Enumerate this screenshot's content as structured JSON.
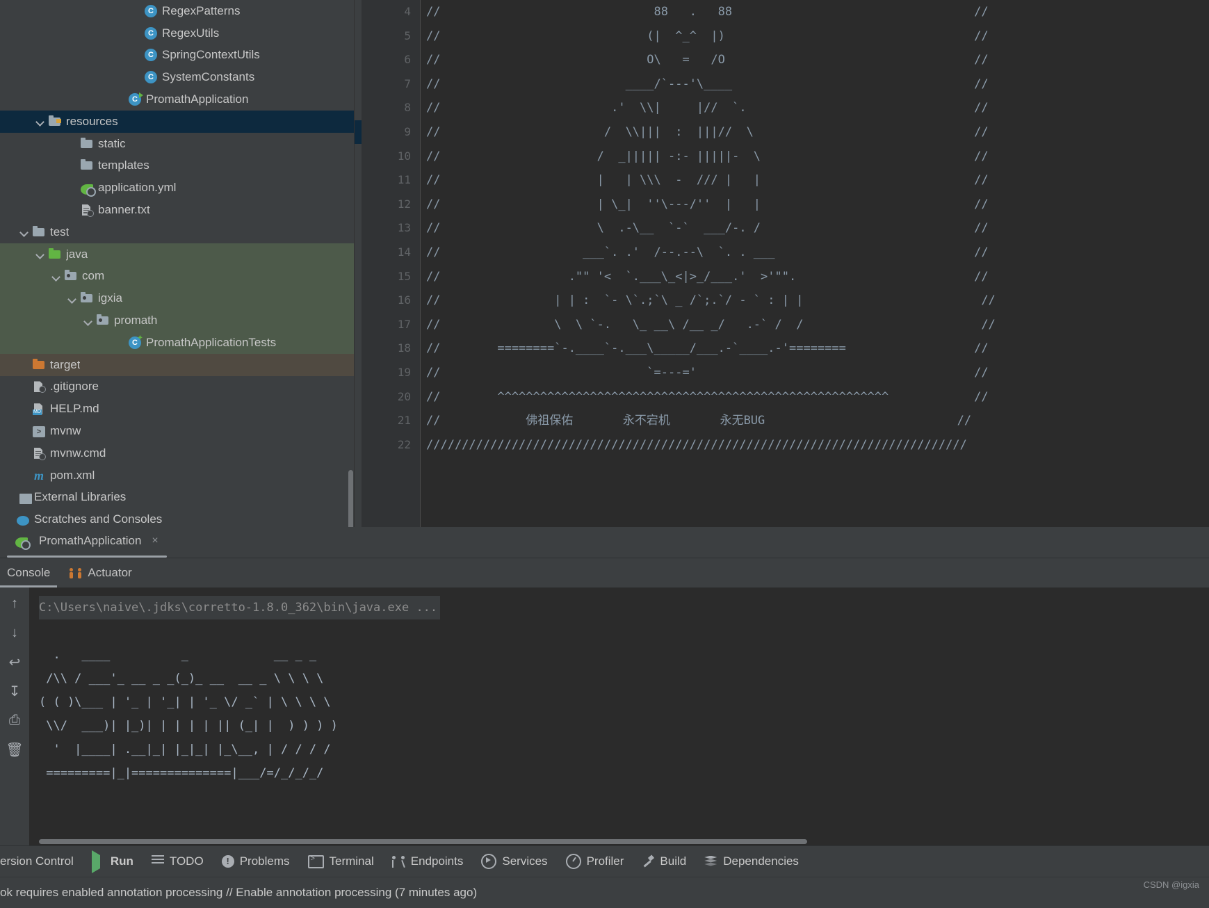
{
  "project_tree": [
    {
      "label": "RegexPatterns",
      "icon": "java-class-icon",
      "indent": 8,
      "chevron": false,
      "state": "normal"
    },
    {
      "label": "RegexUtils",
      "icon": "java-class-icon",
      "indent": 8,
      "chevron": false,
      "state": "normal"
    },
    {
      "label": "SpringContextUtils",
      "icon": "java-class-icon",
      "indent": 8,
      "chevron": false,
      "state": "normal"
    },
    {
      "label": "SystemConstants",
      "icon": "java-class-icon",
      "indent": 8,
      "chevron": false,
      "state": "normal"
    },
    {
      "label": "PromathApplication",
      "icon": "spring-boot-run-icon",
      "indent": 7,
      "chevron": false,
      "state": "normal"
    },
    {
      "label": "resources",
      "icon": "resources-folder-icon",
      "indent": 2,
      "chevron": true,
      "state": "selected"
    },
    {
      "label": "static",
      "icon": "folder-icon",
      "indent": 4,
      "chevron": false,
      "state": "normal"
    },
    {
      "label": "templates",
      "icon": "folder-icon",
      "indent": 4,
      "chevron": false,
      "state": "normal"
    },
    {
      "label": "application.yml",
      "icon": "spring-yaml-icon",
      "indent": 4,
      "chevron": false,
      "state": "normal"
    },
    {
      "label": "banner.txt",
      "icon": "text-file-icon",
      "indent": 4,
      "chevron": false,
      "state": "normal"
    },
    {
      "label": "test",
      "icon": "folder-icon",
      "indent": 1,
      "chevron": true,
      "state": "normal"
    },
    {
      "label": "java",
      "icon": "source-folder-icon",
      "indent": 2,
      "chevron": true,
      "state": "module"
    },
    {
      "label": "com",
      "icon": "package-folder-icon",
      "indent": 3,
      "chevron": true,
      "state": "module"
    },
    {
      "label": "igxia",
      "icon": "package-folder-icon",
      "indent": 4,
      "chevron": true,
      "state": "module"
    },
    {
      "label": "promath",
      "icon": "package-folder-icon",
      "indent": 5,
      "chevron": true,
      "state": "module"
    },
    {
      "label": "PromathApplicationTests",
      "icon": "java-test-class-icon",
      "indent": 7,
      "chevron": false,
      "state": "module"
    },
    {
      "label": "target",
      "icon": "excluded-folder-icon",
      "indent": 1,
      "chevron": false,
      "state": "excluded"
    },
    {
      "label": ".gitignore",
      "icon": "gitignore-file-icon",
      "indent": 1,
      "chevron": false,
      "state": "normal"
    },
    {
      "label": "HELP.md",
      "icon": "markdown-file-icon",
      "indent": 1,
      "chevron": false,
      "state": "normal"
    },
    {
      "label": "mvnw",
      "icon": "shell-script-icon",
      "indent": 1,
      "chevron": false,
      "state": "normal"
    },
    {
      "label": "mvnw.cmd",
      "icon": "text-file-icon",
      "indent": 1,
      "chevron": false,
      "state": "normal"
    },
    {
      "label": "pom.xml",
      "icon": "maven-file-icon",
      "indent": 1,
      "chevron": false,
      "state": "normal"
    },
    {
      "label": "External Libraries",
      "icon": "external-libraries-icon",
      "indent": 0,
      "chevron": false,
      "state": "normal"
    },
    {
      "label": "Scratches and Consoles",
      "icon": "scratches-icon",
      "indent": 0,
      "chevron": false,
      "state": "normal"
    }
  ],
  "editor": {
    "line_numbers": [
      "4",
      "5",
      "6",
      "7",
      "8",
      "9",
      "10",
      "11",
      "12",
      "13",
      "14",
      "15",
      "16",
      "17",
      "18",
      "19",
      "20",
      "21",
      "22"
    ],
    "selected_line": "9",
    "lines": [
      "//                              88   .   88                                  //",
      "//                             (|  ^_^  |)                                   //",
      "//                             O\\   =   /O                                   //",
      "//                          ____/`---'\\____                                  //",
      "//                        .'  \\\\|     |//  `.                                //",
      "//                       /  \\\\|||  :  |||//  \\                               //",
      "//                      /  _||||| -:- |||||-  \\                              //",
      "//                      |   | \\\\\\  -  /// |   |                              //",
      "//                      | \\_|  ''\\---/''  |   |                              //",
      "//                      \\  .-\\__  `-`  ___/-. /                              //",
      "//                    ___`. .'  /--.--\\  `. . ___                            //",
      "//                  .\"\" '<  `.___\\_<|>_/___.'  >'\"\".                         //",
      "//                | | :  `- \\`.;`\\ _ /`;.`/ - ` : | |                         //",
      "//                \\  \\ `-.   \\_ __\\ /__ _/   .-` /  /                         //",
      "//        ========`-.____`-.___\\_____/___.-`____.-'========                  //",
      "//                             `=---='                                       //",
      "//        ^^^^^^^^^^^^^^^^^^^^^^^^^^^^^^^^^^^^^^^^^^^^^^^^^^^^^^^            //",
      "//            佛祖保佑       永不宕机       永无BUG                           //",
      "////////////////////////////////////////////////////////////////////////////"
    ]
  },
  "run_window": {
    "tab_title": "PromathApplication",
    "close_label": "×",
    "sub_tabs": [
      {
        "label": "Console",
        "icon": "console-icon",
        "active": true
      },
      {
        "label": "Actuator",
        "icon": "actuator-icon",
        "active": false
      }
    ],
    "console": {
      "command_line": "C:\\Users\\naive\\.jdks\\corretto-1.8.0_362\\bin\\java.exe ...",
      "banner": [
        "  .   ____          _            __ _ _",
        " /\\\\ / ___'_ __ _ _(_)_ __  __ _ \\ \\ \\ \\",
        "( ( )\\___ | '_ | '_| | '_ \\/ _` | \\ \\ \\ \\",
        " \\\\/  ___)| |_)| | | | | || (_| |  ) ) ) )",
        "  '  |____| .__|_| |_|_| |_\\__, | / / / /",
        " =========|_|==============|___/=/_/_/_/"
      ]
    },
    "toolbar_icons": [
      {
        "name": "scroll-up-icon",
        "glyph": "↑"
      },
      {
        "name": "scroll-down-icon",
        "glyph": "↓"
      },
      {
        "name": "soft-wrap-icon",
        "glyph": "↩"
      },
      {
        "name": "scroll-to-end-icon",
        "glyph": "↧"
      },
      {
        "name": "print-icon",
        "glyph": "⎙"
      },
      {
        "name": "clear-all-icon",
        "glyph": "🗑"
      }
    ]
  },
  "bottom_toolbar": [
    {
      "label": "ersion Control",
      "icon": "version-control-icon",
      "active": false
    },
    {
      "label": "Run",
      "icon": "run-icon",
      "active": true
    },
    {
      "label": "TODO",
      "icon": "todo-icon",
      "active": false
    },
    {
      "label": "Problems",
      "icon": "problems-icon",
      "active": false
    },
    {
      "label": "Terminal",
      "icon": "terminal-icon",
      "active": false
    },
    {
      "label": "Endpoints",
      "icon": "endpoints-icon",
      "active": false
    },
    {
      "label": "Services",
      "icon": "services-icon",
      "active": false
    },
    {
      "label": "Profiler",
      "icon": "profiler-icon",
      "active": false
    },
    {
      "label": "Build",
      "icon": "build-icon",
      "active": false
    },
    {
      "label": "Dependencies",
      "icon": "dependencies-icon",
      "active": false
    }
  ],
  "status_bar": {
    "message": "ok requires enabled annotation processing // Enable annotation processing (7 minutes ago)",
    "watermark": "CSDN @igxia"
  },
  "colors": {
    "background": "#3c3f41",
    "editor_background": "#2b2b2b",
    "selection_blue": "#0d293e",
    "module_green": "#4d5a4a",
    "excluded_brown": "#504a41",
    "text": "#c7c7c7",
    "code_text": "#8a9aa9",
    "accent_blue": "#3d94c4",
    "accent_green": "#62b543",
    "accent_orange": "#cc7832"
  }
}
